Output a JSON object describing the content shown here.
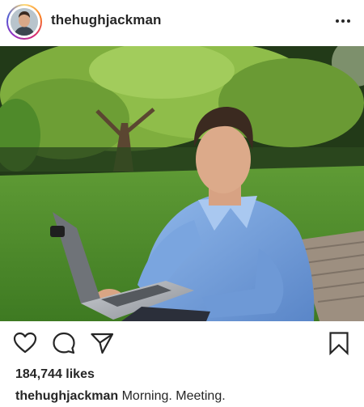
{
  "post": {
    "username": "thehughjackman",
    "likes_text": "184,744 likes",
    "caption_user": "thehughjackman",
    "caption_text": "Morning. Meeting."
  },
  "icons": {
    "more": "more-options-icon",
    "like": "heart-icon",
    "comment": "comment-icon",
    "share": "paper-plane-icon",
    "save": "bookmark-icon"
  },
  "colors": {
    "text": "#262626",
    "ring_gradient": [
      "#feda75",
      "#fa7e1e",
      "#d62976",
      "#962fbf",
      "#4f5bd5"
    ]
  }
}
